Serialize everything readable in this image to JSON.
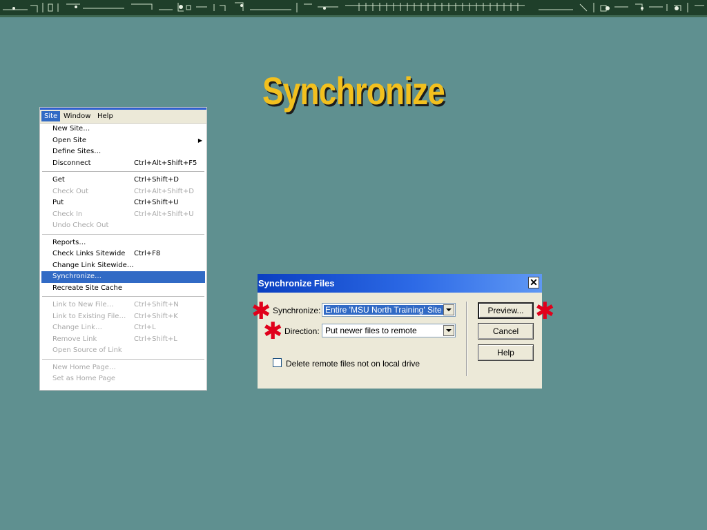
{
  "slide": {
    "title": "Synchronize"
  },
  "menu": {
    "menubar": [
      "Site",
      "Window",
      "Help"
    ],
    "groups": [
      [
        {
          "label": "New Site…",
          "shortcut": "",
          "disabled": false
        },
        {
          "label": "Open Site",
          "shortcut": "",
          "disabled": false,
          "submenu": true
        },
        {
          "label": "Define Sites…",
          "shortcut": "",
          "disabled": false
        },
        {
          "label": "Disconnect",
          "shortcut": "Ctrl+Alt+Shift+F5",
          "disabled": false
        }
      ],
      [
        {
          "label": "Get",
          "shortcut": "Ctrl+Shift+D",
          "disabled": false
        },
        {
          "label": "Check Out",
          "shortcut": "Ctrl+Alt+Shift+D",
          "disabled": true
        },
        {
          "label": "Put",
          "shortcut": "Ctrl+Shift+U",
          "disabled": false
        },
        {
          "label": "Check In",
          "shortcut": "Ctrl+Alt+Shift+U",
          "disabled": true
        },
        {
          "label": "Undo Check Out",
          "shortcut": "",
          "disabled": true
        }
      ],
      [
        {
          "label": "Reports…",
          "shortcut": "",
          "disabled": false
        },
        {
          "label": "Check Links Sitewide",
          "shortcut": "Ctrl+F8",
          "disabled": false
        },
        {
          "label": "Change Link Sitewide…",
          "shortcut": "",
          "disabled": false
        },
        {
          "label": "Synchronize…",
          "shortcut": "",
          "disabled": false,
          "selected": true
        },
        {
          "label": "Recreate Site Cache",
          "shortcut": "",
          "disabled": false
        }
      ],
      [
        {
          "label": "Link to New File…",
          "shortcut": "Ctrl+Shift+N",
          "disabled": true
        },
        {
          "label": "Link to Existing File…",
          "shortcut": "Ctrl+Shift+K",
          "disabled": true
        },
        {
          "label": "Change Link…",
          "shortcut": "Ctrl+L",
          "disabled": true
        },
        {
          "label": "Remove Link",
          "shortcut": "Ctrl+Shift+L",
          "disabled": true
        },
        {
          "label": "Open Source of Link",
          "shortcut": "",
          "disabled": true
        }
      ],
      [
        {
          "label": "New Home Page…",
          "shortcut": "",
          "disabled": true
        },
        {
          "label": "Set as Home Page",
          "shortcut": "",
          "disabled": true
        }
      ]
    ]
  },
  "dialog": {
    "title": "Synchronize Files",
    "close_glyph": "✕",
    "synchronize_label": "Synchronize:",
    "synchronize_value": "Entire 'MSU North Training' Site",
    "direction_label": "Direction:",
    "direction_value": "Put newer files to remote",
    "delete_remote_label": "Delete remote files not on local drive",
    "delete_remote_checked": false,
    "buttons": {
      "preview": "Preview...",
      "cancel": "Cancel",
      "help": "Help"
    }
  },
  "annotations": {
    "marker_glyph": "✱",
    "marker_color": "#e0001b"
  },
  "colors": {
    "background": "#5f9090",
    "title": "#f2c01e",
    "highlight": "#316ac5"
  }
}
